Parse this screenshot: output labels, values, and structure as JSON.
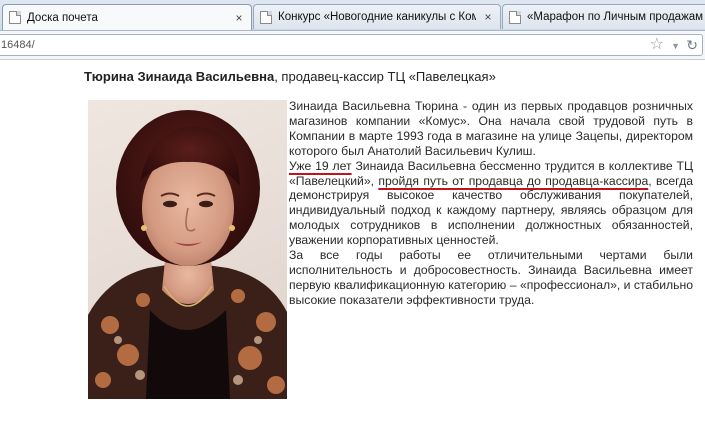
{
  "browser": {
    "tabs": [
      {
        "title": "Доска почета",
        "active": true
      },
      {
        "title": "Конкурс «Новогодние каникулы с Ком",
        "active": false
      },
      {
        "title": "«Марафон по Личным продажам - 2",
        "active": false
      }
    ],
    "close_glyph": "×",
    "url": "16484/",
    "icons": {
      "star": "star-icon",
      "dropdown": "chevron-down-icon",
      "reload": "reload-icon"
    }
  },
  "page": {
    "heading": {
      "name": "Тюрина Зинаида Васильевна",
      "rest": ", продавец-кассир ТЦ «Павелецкая»"
    },
    "paragraphs": {
      "p1": "Зинаида Васильевна Тюрина - один из первых продавцов розничных магазинов компании «Комус». Она начала свой трудовой путь в Компании в марте 1993 года в магазине на улице Зацепы, директором которого был Анатолий Васильевич Кулиш.",
      "p2_underlined_start": "Уже 19 лет",
      "p2_mid": " Зинаида Васильевна бессменно трудится в коллективе ТЦ «Павелецкий», ",
      "p2_underlined_mid": "пройдя путь от продавца до продавца-кассира",
      "p2_end": ", всегда демонстрируя высокое качество обслуживания покупателей, индивидуальный подход к каждому партнеру, являясь образцом для молодых сотрудников в исполнении должностных обязанностей, уважении корпоративных ценностей.",
      "p3": "За все годы работы ее отличительными чертами были исполнительность и добросовестность. Зинаида Васильевна имеет первую квалификационную категорию – «профессионал», и стабильно высокие показатели эффективности труда."
    },
    "annotation_color": "#c0141c"
  }
}
